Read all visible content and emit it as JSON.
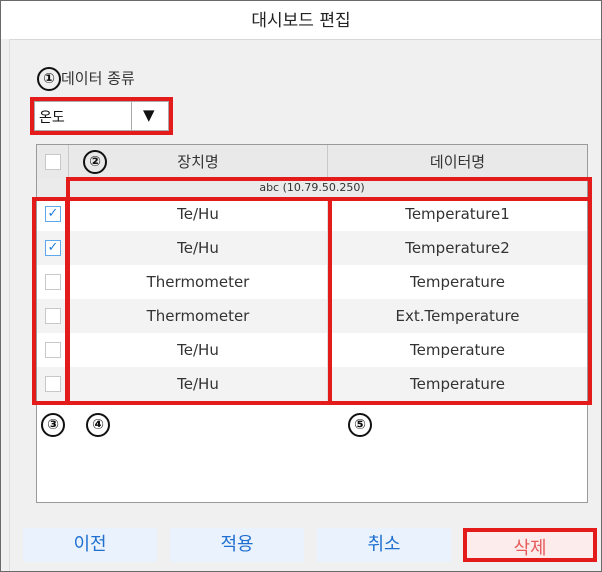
{
  "title": "대시보드 편집",
  "data_type": {
    "marker": "①",
    "label": "데이터 종류",
    "selected": "온도"
  },
  "table": {
    "marker": "②",
    "headers": {
      "device": "장치명",
      "data": "데이터명"
    },
    "group": "abc (10.79.50.250)",
    "rows": [
      {
        "checked": true,
        "device": "Te/Hu",
        "data": "Temperature1"
      },
      {
        "checked": true,
        "device": "Te/Hu",
        "data": "Temperature2"
      },
      {
        "checked": false,
        "device": "Thermometer",
        "data": "Temperature"
      },
      {
        "checked": false,
        "device": "Thermometer",
        "data": "Ext.Temperature"
      },
      {
        "checked": false,
        "device": "Te/Hu",
        "data": "Temperature"
      },
      {
        "checked": false,
        "device": "Te/Hu",
        "data": "Temperature"
      }
    ]
  },
  "markers": {
    "checkbox_col": "③",
    "device_col": "④",
    "data_col": "⑤"
  },
  "buttons": {
    "prev": "이전",
    "apply": "적용",
    "cancel": "취소",
    "delete": "삭제"
  },
  "colors": {
    "highlight": "#e31b1b",
    "button_blue_text": "#1e6fd0",
    "button_red_text": "#e85b5b"
  }
}
